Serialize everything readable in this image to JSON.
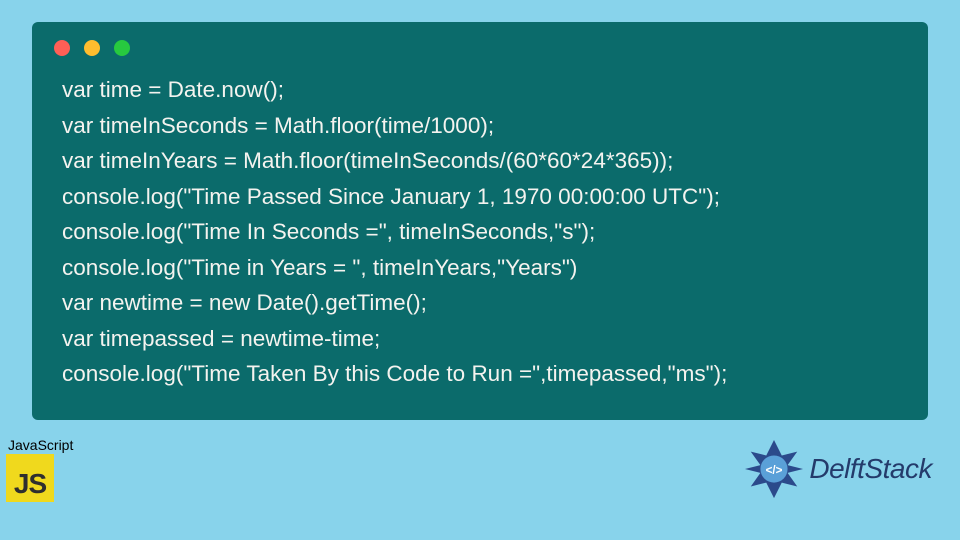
{
  "code": {
    "lines": [
      "var time = Date.now();",
      "var timeInSeconds = Math.floor(time/1000);",
      "var timeInYears = Math.floor(timeInSeconds/(60*60*24*365));",
      "console.log(\"Time Passed Since January 1, 1970 00:00:00 UTC\");",
      "console.log(\"Time In Seconds =\", timeInSeconds,\"s\");",
      "console.log(\"Time in Years = \", timeInYears,\"Years\")",
      "var newtime = new Date().getTime();",
      "var timepassed = newtime-time;",
      "console.log(\"Time Taken By this Code to Run =\",timepassed,\"ms\");"
    ]
  },
  "badges": {
    "js_label": "JavaScript",
    "js_logo_text": "JS",
    "delft_text": "DelftStack"
  }
}
